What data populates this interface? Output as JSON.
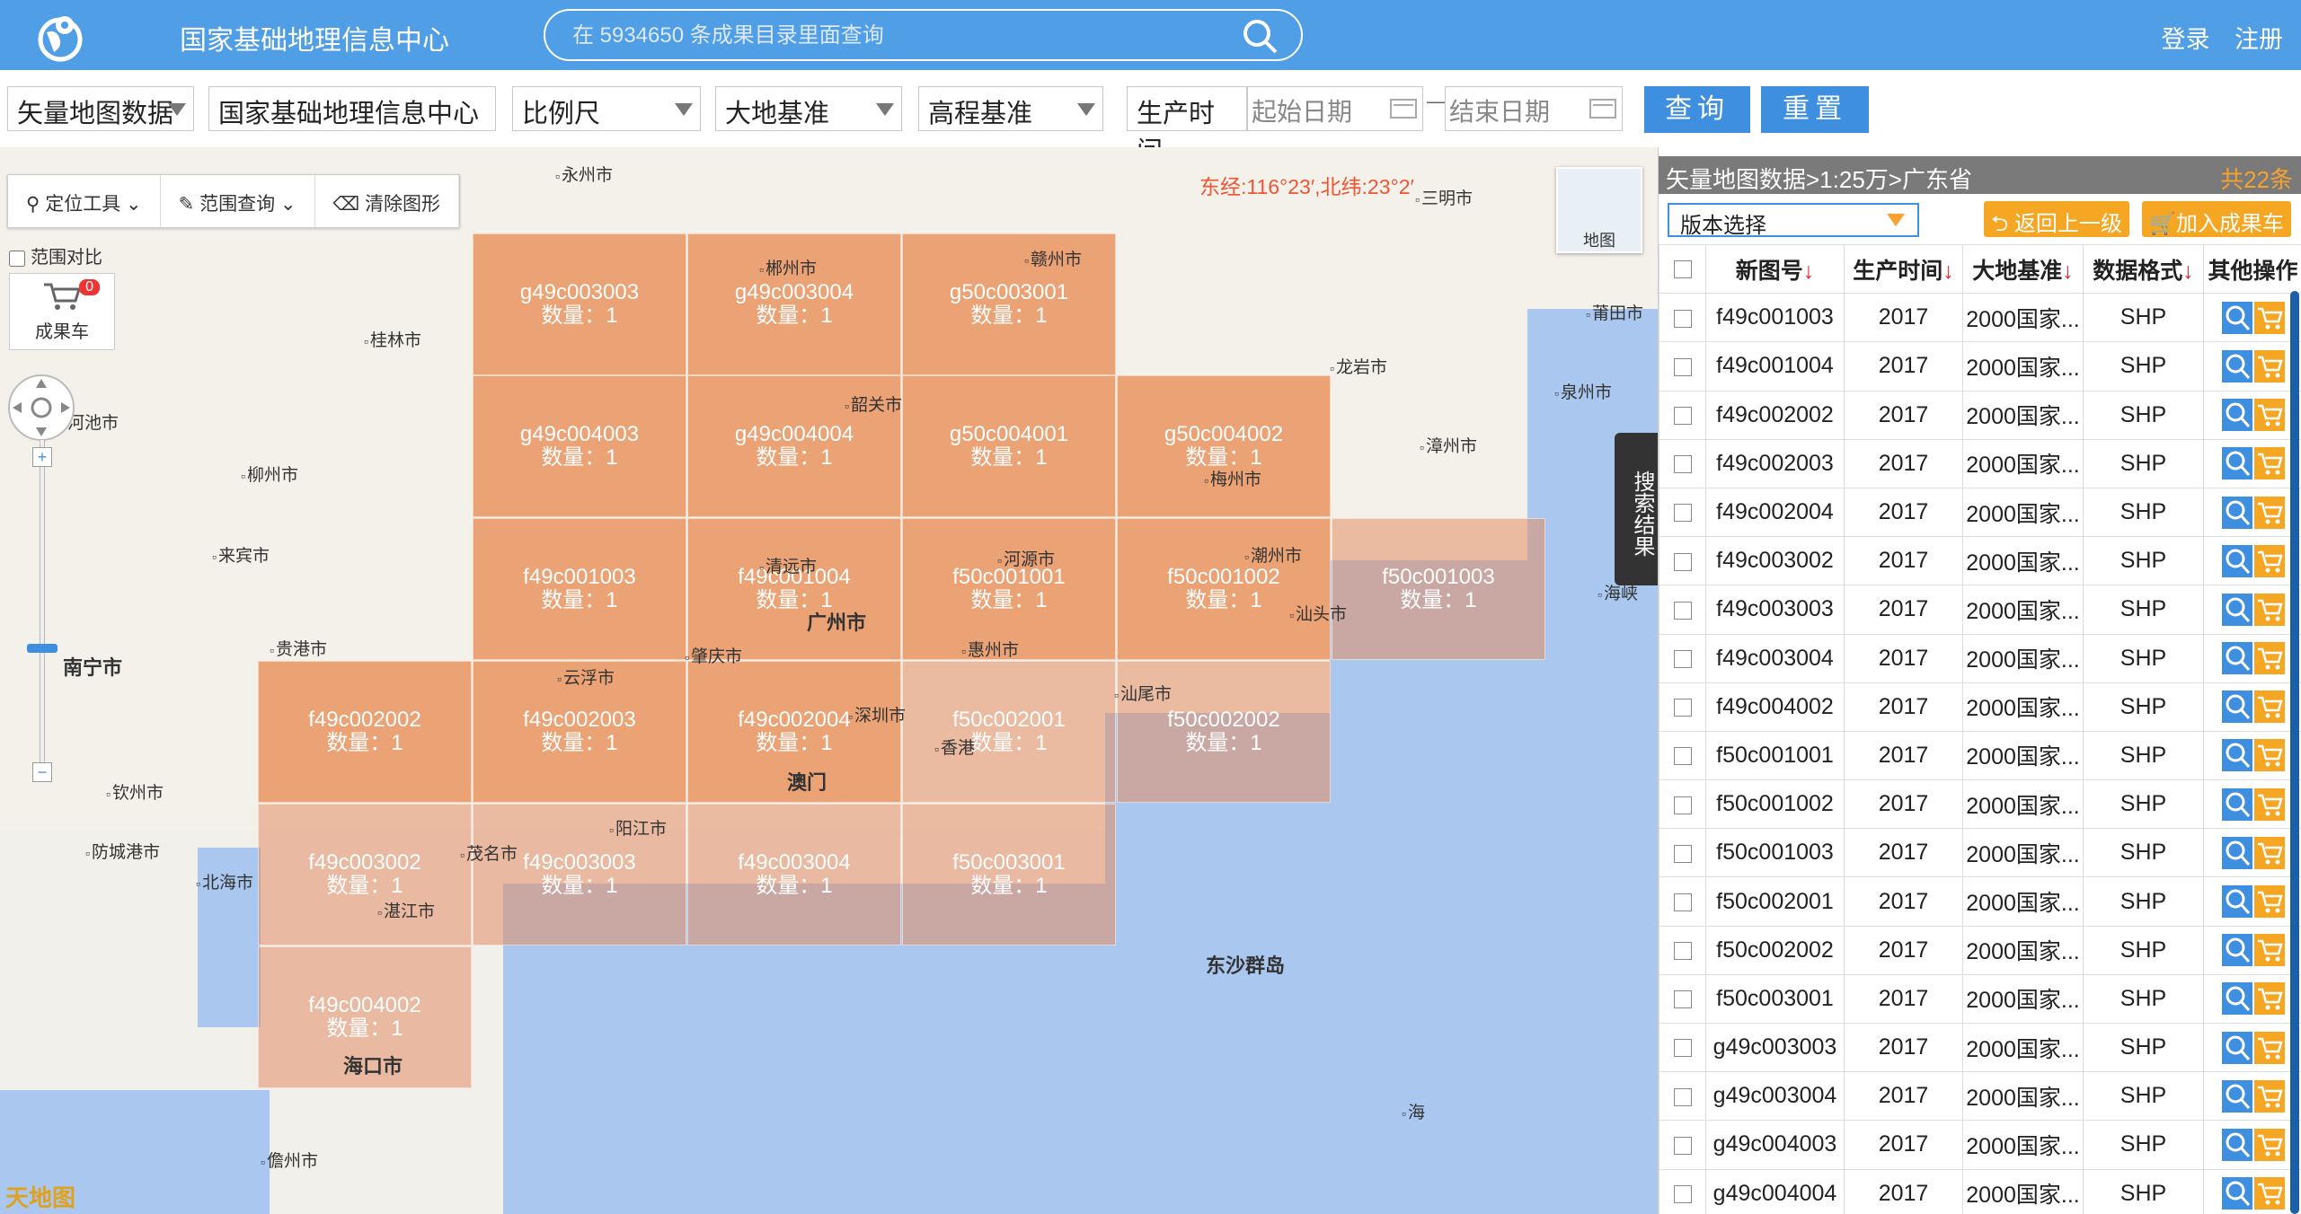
{
  "header": {
    "title": "国家基础地理信息中心",
    "search_placeholder": "在 5934650 条成果目录里面查询",
    "login": "登录",
    "register": "注册"
  },
  "filters": {
    "data_type": "矢量地图数据",
    "org": "国家基础地理信息中心",
    "scale": "比例尺",
    "geodetic": "大地基准",
    "elevation": "高程基准",
    "prod_time_label": "生产时间",
    "start_placeholder": "起始日期",
    "end_placeholder": "结束日期",
    "date_sep": "—",
    "query": "查询",
    "reset": "重置"
  },
  "map": {
    "tools": {
      "locate": "定位工具",
      "range": "范围查询",
      "clear": "清除图形"
    },
    "compare_label": "范围对比",
    "cart_label": "成果车",
    "cart_count": "0",
    "coords": "东经:116°23′,北纬:23°2′",
    "minimap_label": "地图",
    "search_tab": "搜索结果",
    "brand": "天地图",
    "tiles": [
      {
        "code": "g49c003003",
        "count": "数量：1"
      },
      {
        "code": "g49c003004",
        "count": "数量：1"
      },
      {
        "code": "g50c003001",
        "count": "数量：1"
      },
      {
        "code": "g49c004003",
        "count": "数量：1"
      },
      {
        "code": "g49c004004",
        "count": "数量：1"
      },
      {
        "code": "g50c004001",
        "count": "数量：1"
      },
      {
        "code": "g50c004002",
        "count": "数量：1"
      },
      {
        "code": "f49c001003",
        "count": "数量：1"
      },
      {
        "code": "f49c001004",
        "count": "数量：1"
      },
      {
        "code": "f50c001001",
        "count": "数量：1"
      },
      {
        "code": "f50c001002",
        "count": "数量：1"
      },
      {
        "code": "f50c001003",
        "count": "数量：1"
      },
      {
        "code": "f49c002002",
        "count": "数量：1"
      },
      {
        "code": "f49c002003",
        "count": "数量：1"
      },
      {
        "code": "f49c002004",
        "count": "数量：1"
      },
      {
        "code": "f50c002001",
        "count": "数量：1"
      },
      {
        "code": "f50c002002",
        "count": "数量：1"
      },
      {
        "code": "f49c003002",
        "count": "数量：1"
      },
      {
        "code": "f49c003003",
        "count": "数量：1"
      },
      {
        "code": "f49c003004",
        "count": "数量：1"
      },
      {
        "code": "f50c003001",
        "count": "数量：1"
      },
      {
        "code": "f49c004002",
        "count": "数量：1"
      }
    ],
    "cities": [
      "永州市",
      "郴州市",
      "赣州市",
      "三明市",
      "莆田市",
      "桂林市",
      "韶关市",
      "龙岩市",
      "泉州市",
      "河池市",
      "柳州市",
      "梅州市",
      "漳州市",
      "来宾市",
      "清远市",
      "河源市",
      "潮州市",
      "汕头市",
      "贵港市",
      "广州市",
      "惠州市",
      "南宁市",
      "云浮市",
      "肇庆市",
      "汕尾市",
      "深圳市",
      "香港",
      "澳门",
      "钦州市",
      "防城港市",
      "阳江市",
      "茂名市",
      "北海市",
      "湛江市",
      "东沙群岛",
      "海口市",
      "儋州市",
      "海",
      "海峡"
    ]
  },
  "panel": {
    "breadcrumb": "矢量地图数据>1:25万>广东省",
    "total": "共22条",
    "version": "版本选择",
    "back": "返回上一级",
    "add_cart": "加入成果车",
    "columns": [
      "新图号",
      "生产时间",
      "大地基准",
      "数据格式",
      "其他操作"
    ],
    "rows": [
      {
        "code": "f49c001003",
        "year": "2017",
        "datum": "2000国家...",
        "format": "SHP"
      },
      {
        "code": "f49c001004",
        "year": "2017",
        "datum": "2000国家...",
        "format": "SHP"
      },
      {
        "code": "f49c002002",
        "year": "2017",
        "datum": "2000国家...",
        "format": "SHP"
      },
      {
        "code": "f49c002003",
        "year": "2017",
        "datum": "2000国家...",
        "format": "SHP"
      },
      {
        "code": "f49c002004",
        "year": "2017",
        "datum": "2000国家...",
        "format": "SHP"
      },
      {
        "code": "f49c003002",
        "year": "2017",
        "datum": "2000国家...",
        "format": "SHP"
      },
      {
        "code": "f49c003003",
        "year": "2017",
        "datum": "2000国家...",
        "format": "SHP"
      },
      {
        "code": "f49c003004",
        "year": "2017",
        "datum": "2000国家...",
        "format": "SHP"
      },
      {
        "code": "f49c004002",
        "year": "2017",
        "datum": "2000国家...",
        "format": "SHP"
      },
      {
        "code": "f50c001001",
        "year": "2017",
        "datum": "2000国家...",
        "format": "SHP"
      },
      {
        "code": "f50c001002",
        "year": "2017",
        "datum": "2000国家...",
        "format": "SHP"
      },
      {
        "code": "f50c001003",
        "year": "2017",
        "datum": "2000国家...",
        "format": "SHP"
      },
      {
        "code": "f50c002001",
        "year": "2017",
        "datum": "2000国家...",
        "format": "SHP"
      },
      {
        "code": "f50c002002",
        "year": "2017",
        "datum": "2000国家...",
        "format": "SHP"
      },
      {
        "code": "f50c003001",
        "year": "2017",
        "datum": "2000国家...",
        "format": "SHP"
      },
      {
        "code": "g49c003003",
        "year": "2017",
        "datum": "2000国家...",
        "format": "SHP"
      },
      {
        "code": "g49c003004",
        "year": "2017",
        "datum": "2000国家...",
        "format": "SHP"
      },
      {
        "code": "g49c004003",
        "year": "2017",
        "datum": "2000国家...",
        "format": "SHP"
      },
      {
        "code": "g49c004004",
        "year": "2017",
        "datum": "2000国家...",
        "format": "SHP"
      }
    ]
  },
  "colors": {
    "header": "#4f9ee6",
    "accent_blue": "#3f8fe0",
    "accent_orange": "#f5a623",
    "tile": "#e88348"
  }
}
